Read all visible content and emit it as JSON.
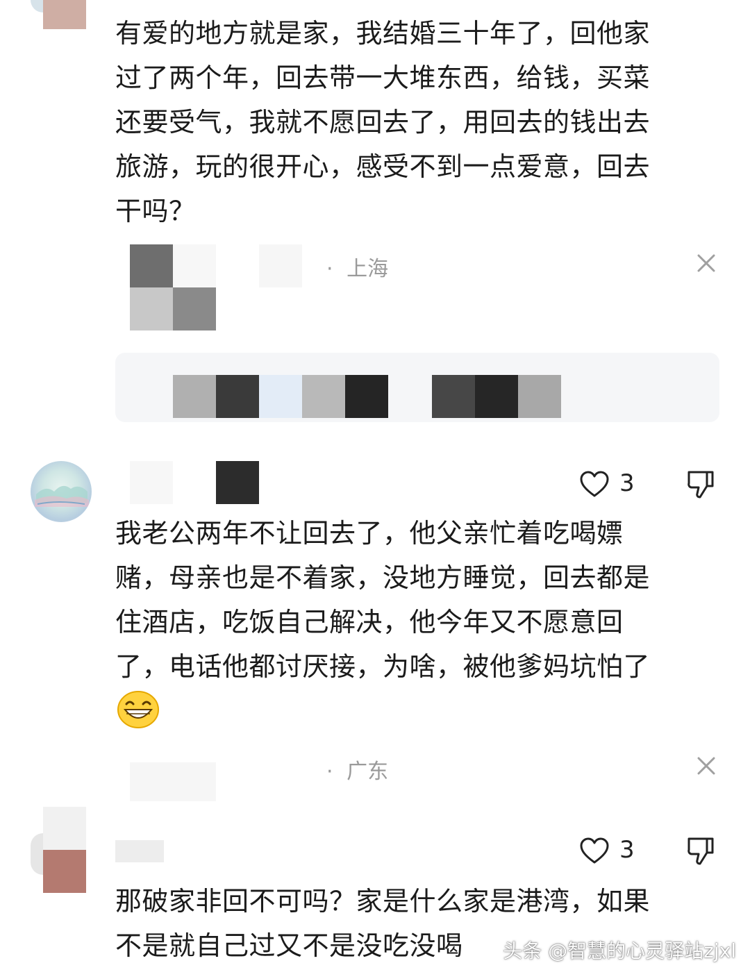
{
  "comments": [
    {
      "text_lines": [
        "有爱的地方就是家，我结婚三十年了，回他家",
        "过了两个年，回去带一大堆东西，给钱，买菜",
        "还要受气，我就不愿回去了，用回去的钱出去",
        "旅游，玩的很开心，感受不到一点爱意，回去",
        "干吗？"
      ],
      "location": "上海"
    },
    {
      "likes": "3",
      "text_lines": [
        "我老公两年不让回去了，他父亲忙着吃喝嫖",
        "赌，母亲也是不着家，没地方睡觉，回去都是",
        "住酒店，吃饭自己解决，他今年又不愿意回",
        "了，电话他都讨厌接，为啥，被他爹妈坑怕了"
      ],
      "emoji": "grinning-face-emoji",
      "location": "广东"
    },
    {
      "likes": "3",
      "text_lines": [
        "那破家非回不可吗？家是什么家是港湾，如果",
        "不是就自己过又不是没吃没喝"
      ]
    }
  ],
  "meta_separator": "·",
  "watermark": "头条 @智慧的心灵驿站zjxl",
  "icons": {
    "like": "heart-outline-icon",
    "dislike": "thumbs-down-icon",
    "close": "close-icon"
  },
  "colors": {
    "text": "#1b1b1b",
    "meta": "#9a9a9a",
    "quote_bg": "#f5f6f8"
  }
}
